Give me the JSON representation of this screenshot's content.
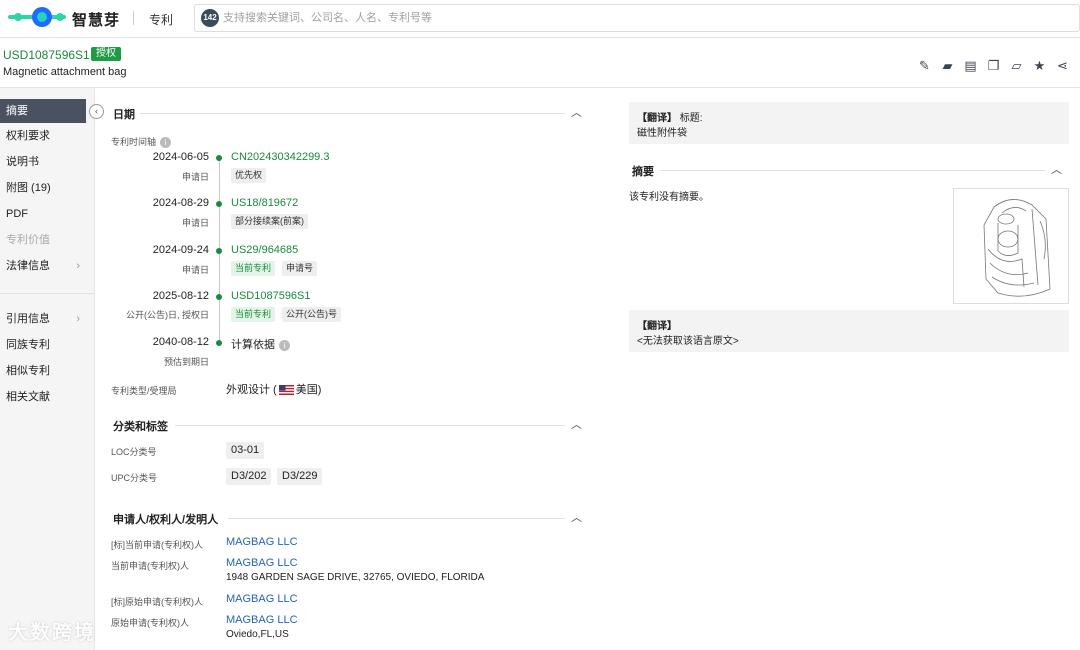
{
  "brand": {
    "name": "智慧芽",
    "product": "专利"
  },
  "search": {
    "count": "142",
    "placeholder": "支持搜索关键词、公司名、人名、专利号等"
  },
  "patent": {
    "number": "USD1087596S1",
    "status": "授权",
    "title_en": "Magnetic attachment bag"
  },
  "toolbar_icons": [
    "edit-doc-icon",
    "folder-icon",
    "pdf-icon",
    "copy-icon",
    "share-folder-icon",
    "star-icon",
    "share-icon"
  ],
  "sidebar": {
    "items": [
      {
        "label": "摘要",
        "active": true
      },
      {
        "label": "权利要求"
      },
      {
        "label": "说明书"
      },
      {
        "label": "附图 (19)"
      },
      {
        "label": "PDF"
      },
      {
        "label": "专利价值",
        "disabled": true
      },
      {
        "label": "法律信息",
        "chevron": true
      },
      {
        "label": "引用信息",
        "chevron": true
      },
      {
        "label": "同族专利"
      },
      {
        "label": "相似专利"
      },
      {
        "label": "相关文献"
      }
    ]
  },
  "dates": {
    "section_title": "日期",
    "timeline_label": "专利时间轴",
    "events": [
      {
        "date": "2024-06-05",
        "sub": "申请日",
        "number": "CN202430342299.3",
        "tags": [
          "优先权"
        ]
      },
      {
        "date": "2024-08-29",
        "sub": "申请日",
        "number": "US18/819672",
        "tags": [
          "部分接续案(前案)"
        ]
      },
      {
        "date": "2024-09-24",
        "sub": "申请日",
        "number": "US29/964685",
        "tags": [
          "当前专利",
          "申请号"
        ]
      },
      {
        "date": "2025-08-12",
        "sub": "公开(公告)日, 授权日",
        "number": "USD1087596S1",
        "tags": [
          "当前专利",
          "公开(公告)号"
        ]
      },
      {
        "date": "2040-08-12",
        "sub": "预估到期日",
        "number": "计算依据",
        "tags": []
      }
    ],
    "type_label": "专利类型/受理局",
    "type_value": "外观设计 (",
    "country": "美国)"
  },
  "classification": {
    "section_title": "分类和标签",
    "loc_label": "LOC分类号",
    "loc_values": [
      "03-01"
    ],
    "upc_label": "UPC分类号",
    "upc_values": [
      "D3/202",
      "D3/229"
    ]
  },
  "parties": {
    "section_title": "申请人/权利人/发明人",
    "rows": [
      {
        "label": "[标]当前申请(专利权)人",
        "name": "MAGBAG LLC",
        "address": ""
      },
      {
        "label": "当前申请(专利权)人",
        "name": "MAGBAG LLC",
        "address": "1948 GARDEN SAGE DRIVE, 32765, OVIEDO, FLORIDA"
      },
      {
        "label": "[标]原始申请(专利权)人",
        "name": "MAGBAG LLC",
        "address": ""
      },
      {
        "label": "原始申请(专利权)人",
        "name": "MAGBAG LLC",
        "address": "Oviedo,FL,US"
      }
    ]
  },
  "right_panel": {
    "translate_tag": "【翻译】",
    "title_label": "标题:",
    "title_cn": "磁性附件袋",
    "abstract_title": "摘要",
    "abstract_text": "该专利没有摘要。",
    "translate_tag2": "【翻译】",
    "translate_msg": "<无法获取该语言原文>"
  },
  "watermark": "大数跨境",
  "colors": {
    "accent_green": "#1a8a3c",
    "link_blue": "#2563b8",
    "active_nav": "#4a5260"
  }
}
